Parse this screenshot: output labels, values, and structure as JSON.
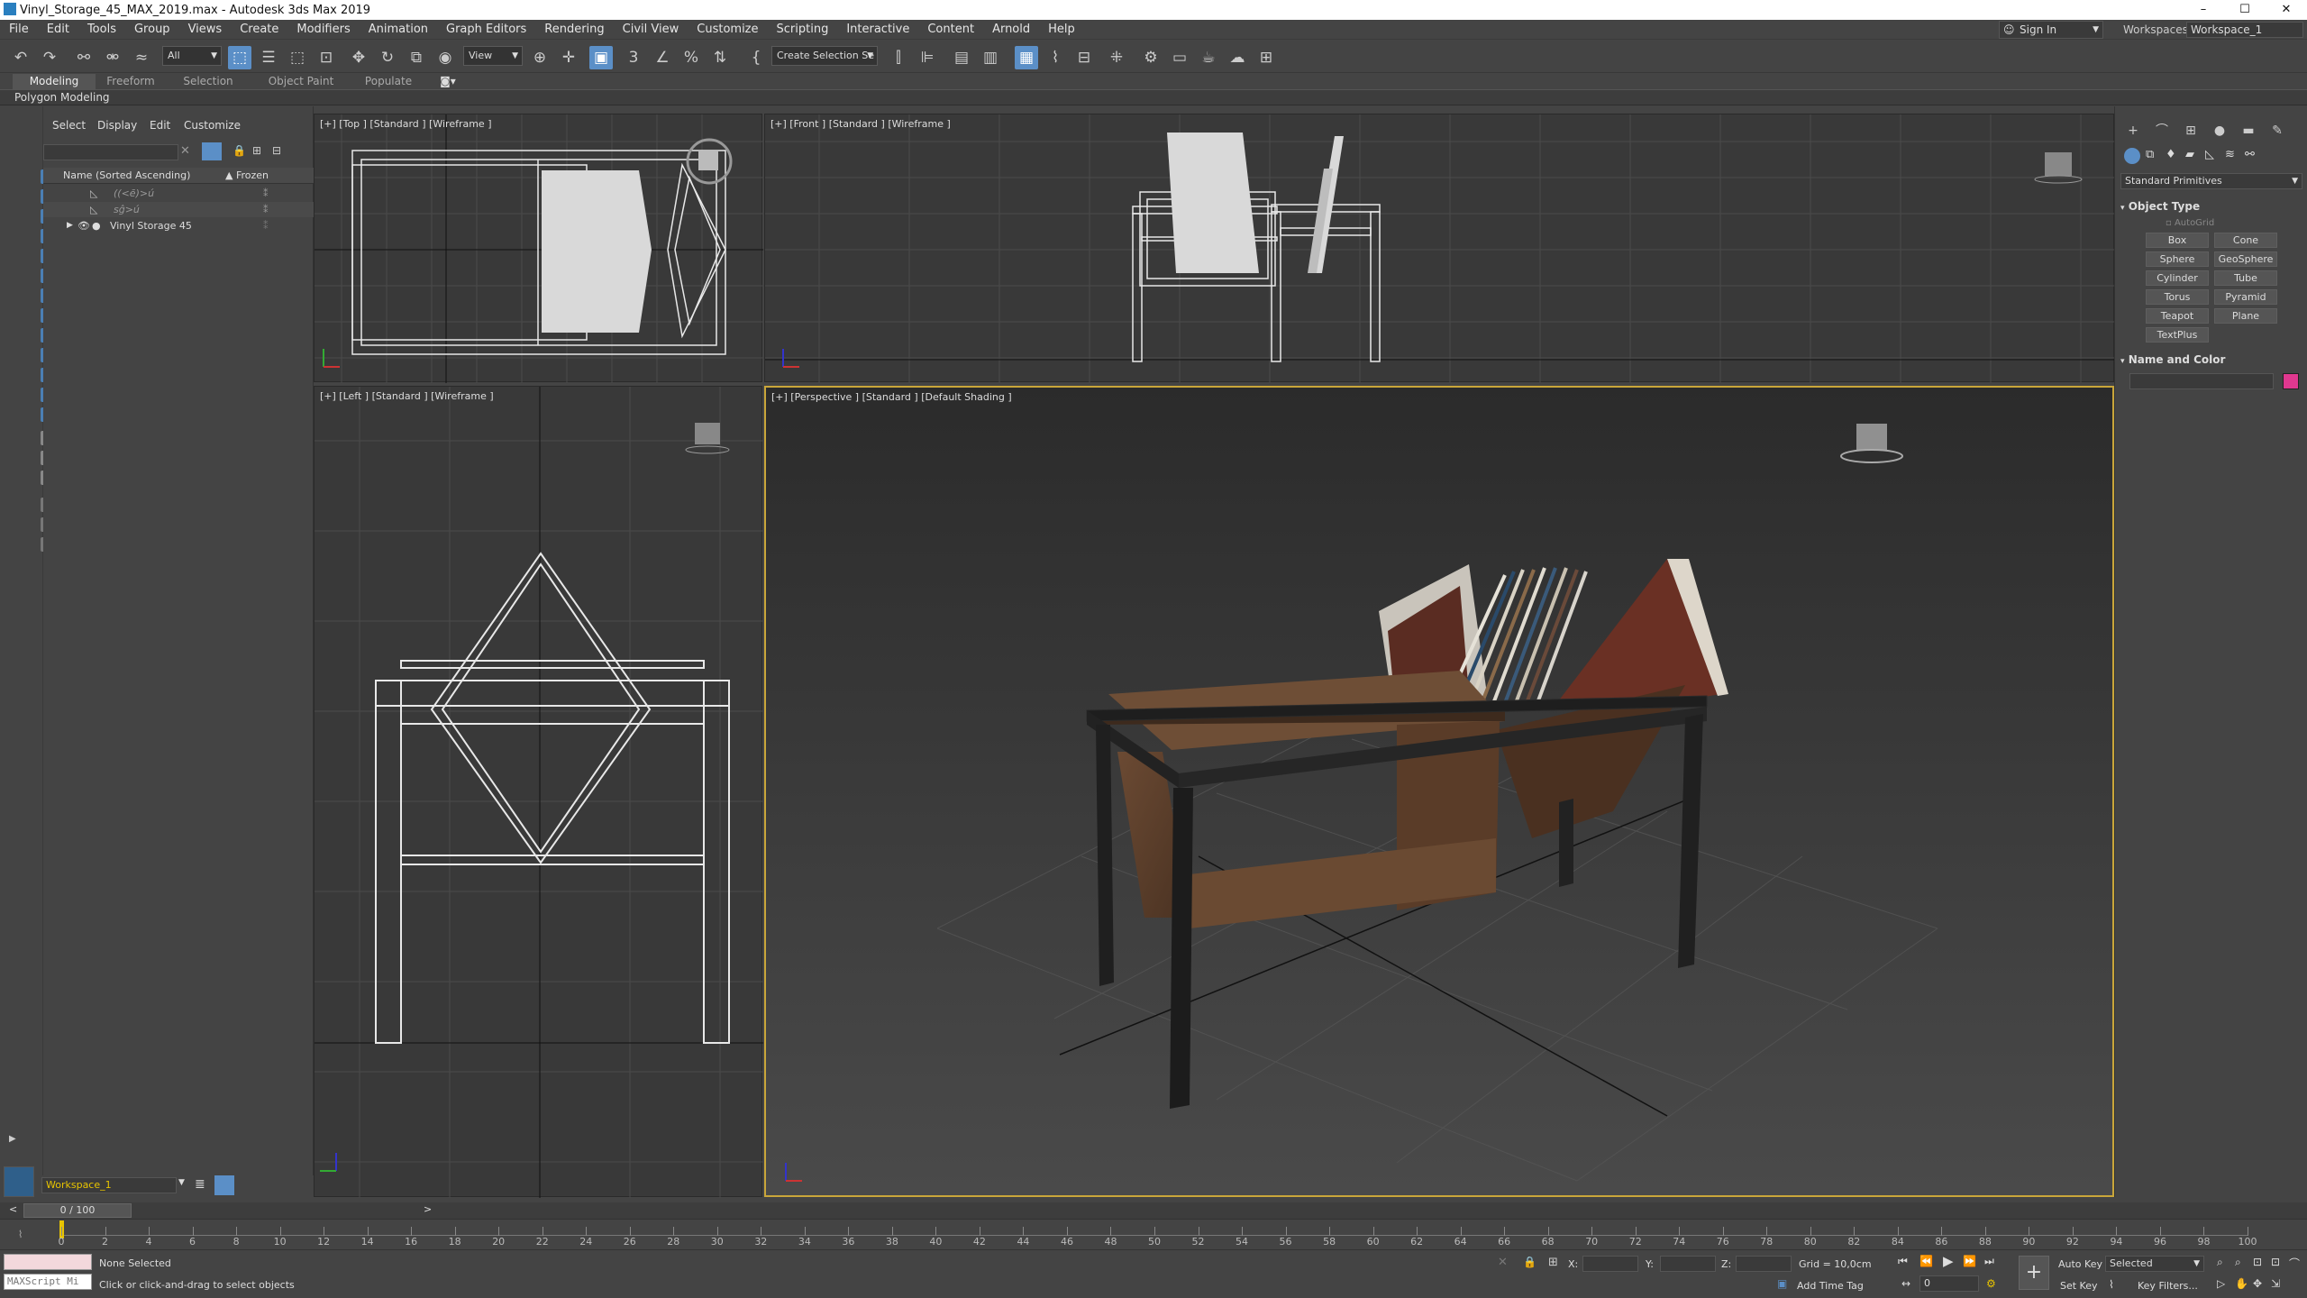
{
  "title": "Vinyl_Storage_45_MAX_2019.max - Autodesk 3ds Max 2019",
  "window_controls": {
    "minimize": "–",
    "maximize": "☐",
    "close": "✕"
  },
  "menu": [
    "File",
    "Edit",
    "Tools",
    "Group",
    "Views",
    "Create",
    "Modifiers",
    "Animation",
    "Graph Editors",
    "Rendering",
    "Civil View",
    "Customize",
    "Scripting",
    "Interactive",
    "Content",
    "Arnold",
    "Help"
  ],
  "account": {
    "sign_in": "Sign In",
    "workspaces_label": "Workspaces:",
    "workspace": "Workspace_1"
  },
  "toolbar": {
    "selection_filter": "All",
    "ref_coord": "View",
    "named_selection": "Create Selection Se"
  },
  "ribbon": {
    "tabs": [
      "Modeling",
      "Freeform",
      "Selection",
      "Object Paint",
      "Populate"
    ],
    "active": "Modeling",
    "subtitle": "Polygon Modeling"
  },
  "explorer": {
    "tabs": [
      "Select",
      "Display",
      "Edit",
      "Customize"
    ],
    "col_name": "Name (Sorted Ascending)",
    "col_frozen": "▲ Frozen",
    "rows": [
      {
        "name": "((<ē)>ú",
        "frozen": "⁑"
      },
      {
        "name": "sĝ>ú",
        "frozen": "⁑"
      },
      {
        "name": "Vinyl Storage 45",
        "frozen": "⁑"
      }
    ]
  },
  "viewports": {
    "top": "[+] [Top ] [Standard ] [Wireframe ]",
    "front": "[+] [Front ] [Standard ] [Wireframe ]",
    "left": "[+] [Left ] [Standard ] [Wireframe ]",
    "perspective": "[+] [Perspective ] [Standard ] [Default Shading ]"
  },
  "command_panel": {
    "category": "Standard Primitives",
    "object_type": "Object Type",
    "autogrid": "AutoGrid",
    "buttons": [
      "Box",
      "Cone",
      "Sphere",
      "GeoSphere",
      "Cylinder",
      "Tube",
      "Torus",
      "Pyramid",
      "Teapot",
      "Plane",
      "TextPlus"
    ],
    "name_and_color": "Name and Color",
    "color": "#e0388f"
  },
  "workspace_bar": {
    "workspace": "Workspace_1"
  },
  "timeline": {
    "frame": "0 / 100",
    "ticks": [
      "0",
      "2",
      "4",
      "6",
      "8",
      "10",
      "12",
      "14",
      "16",
      "18",
      "20",
      "22",
      "24",
      "26",
      "28",
      "30",
      "32",
      "34",
      "36",
      "38",
      "40",
      "42",
      "44",
      "46",
      "48",
      "50",
      "52",
      "54",
      "56",
      "58",
      "60",
      "62",
      "64",
      "66",
      "68",
      "70",
      "72",
      "74",
      "76",
      "78",
      "80",
      "82",
      "84",
      "86",
      "88",
      "90",
      "92",
      "94",
      "96",
      "98",
      "100"
    ]
  },
  "status": {
    "maxscript": "MAXScript Mi",
    "selection": "None Selected",
    "prompt": "Click or click-and-drag to select objects",
    "x_label": "X:",
    "y_label": "Y:",
    "z_label": "Z:",
    "grid": "Grid = 10,0cm",
    "add_time_tag": "Add Time Tag",
    "auto_key": "Auto Key",
    "set_key": "Set Key",
    "selected": "Selected",
    "key_filters": "Key Filters...",
    "current_frame": "0"
  }
}
